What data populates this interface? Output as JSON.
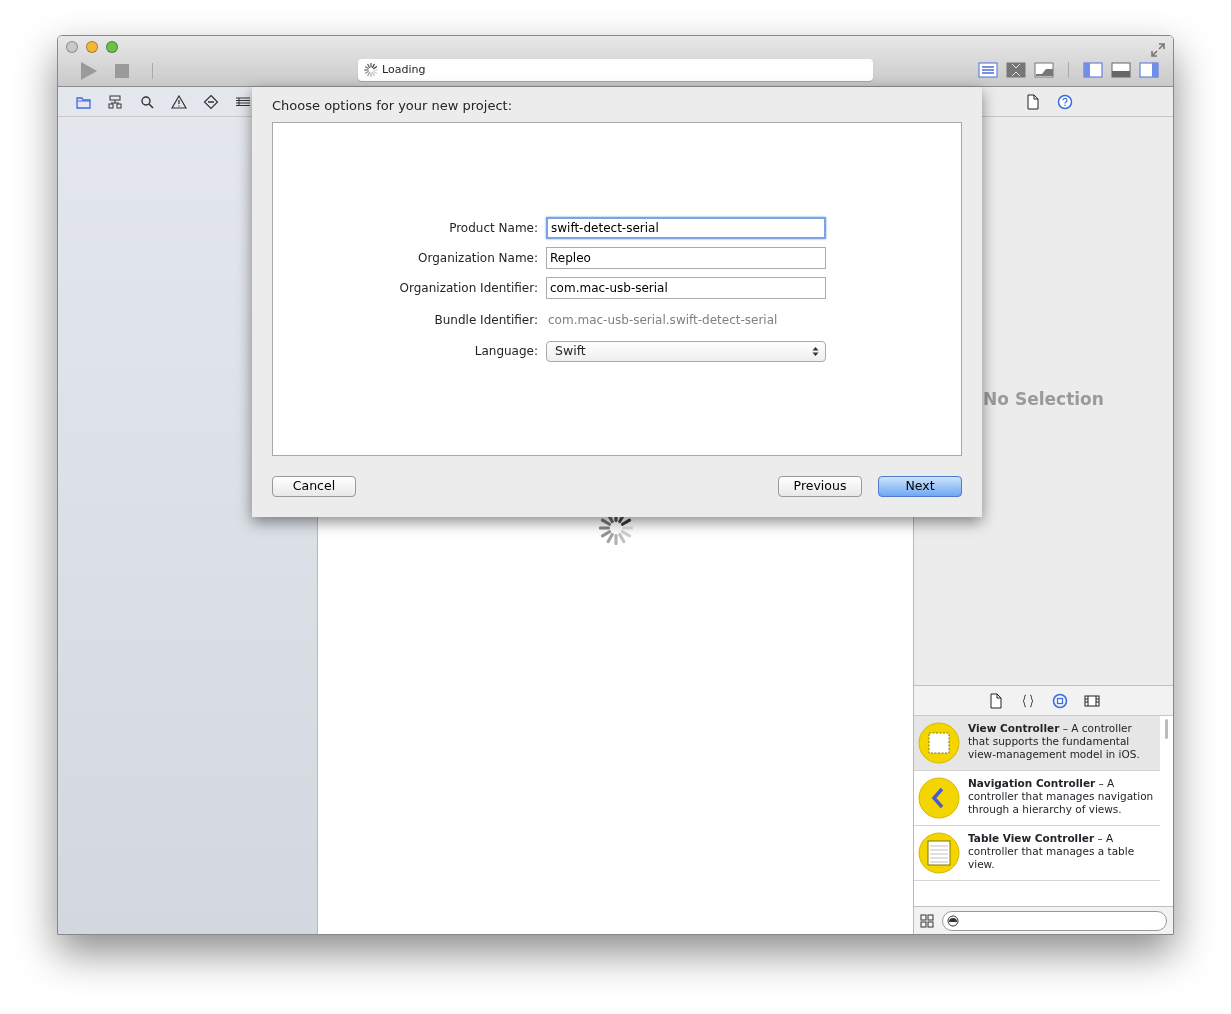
{
  "window_controls": [
    {
      "color": "#c8c8c8"
    },
    {
      "color": "#f2b838"
    },
    {
      "color": "#6cc04a"
    }
  ],
  "toolbar": {
    "run_enabled": false,
    "status": "Loading",
    "editor_modes": [
      {
        "selected": true
      },
      {
        "selected": false
      },
      {
        "selected": false
      }
    ],
    "panels": [
      {
        "selected": true
      },
      {
        "selected": false
      },
      {
        "selected": true
      }
    ]
  },
  "navigator": {
    "tabs": [
      {
        "selected": true
      },
      {
        "selected": false
      },
      {
        "selected": false
      },
      {
        "selected": false
      },
      {
        "selected": false
      },
      {
        "selected": false
      }
    ]
  },
  "inspector": {
    "tabs": [
      {
        "selected": false
      },
      {
        "selected": true
      }
    ],
    "empty_text": "No Selection"
  },
  "library": {
    "tabs": [
      {
        "selected": false
      },
      {
        "selected": false
      },
      {
        "selected": true
      },
      {
        "selected": false
      }
    ],
    "items": [
      {
        "kind": "view",
        "text": "**View Controller** – A controller that supports the fundamental view-management model in iOS.",
        "selected": true
      },
      {
        "kind": "navigation",
        "text": "**Navigation Controller** – A controller that manages navigation through a hierarchy of views.",
        "selected": false
      },
      {
        "kind": "table",
        "text": "**Table View Controller** – A controller that manages a table view.",
        "selected": false
      }
    ]
  },
  "dialog": {
    "title": "Choose options for your new project:",
    "fields": [
      {
        "kind": "text",
        "label": "Product Name:",
        "value": "swift-detect-serial",
        "focused": true
      },
      {
        "kind": "text",
        "label": "Organization Name:",
        "value": "Repleo",
        "focused": false
      },
      {
        "kind": "text",
        "label": "Organization Identifier:",
        "value": "com.mac-usb-serial",
        "focused": false
      },
      {
        "kind": "static",
        "label": "Bundle Identifier:",
        "value": "com.mac-usb-serial.swift-detect-serial"
      },
      {
        "kind": "popup",
        "label": "Language:",
        "value": "Swift"
      }
    ],
    "buttons": [
      {
        "label": "Cancel",
        "default": false
      },
      {
        "label": "Previous",
        "default": false
      },
      {
        "label": "Next",
        "default": true
      }
    ]
  }
}
